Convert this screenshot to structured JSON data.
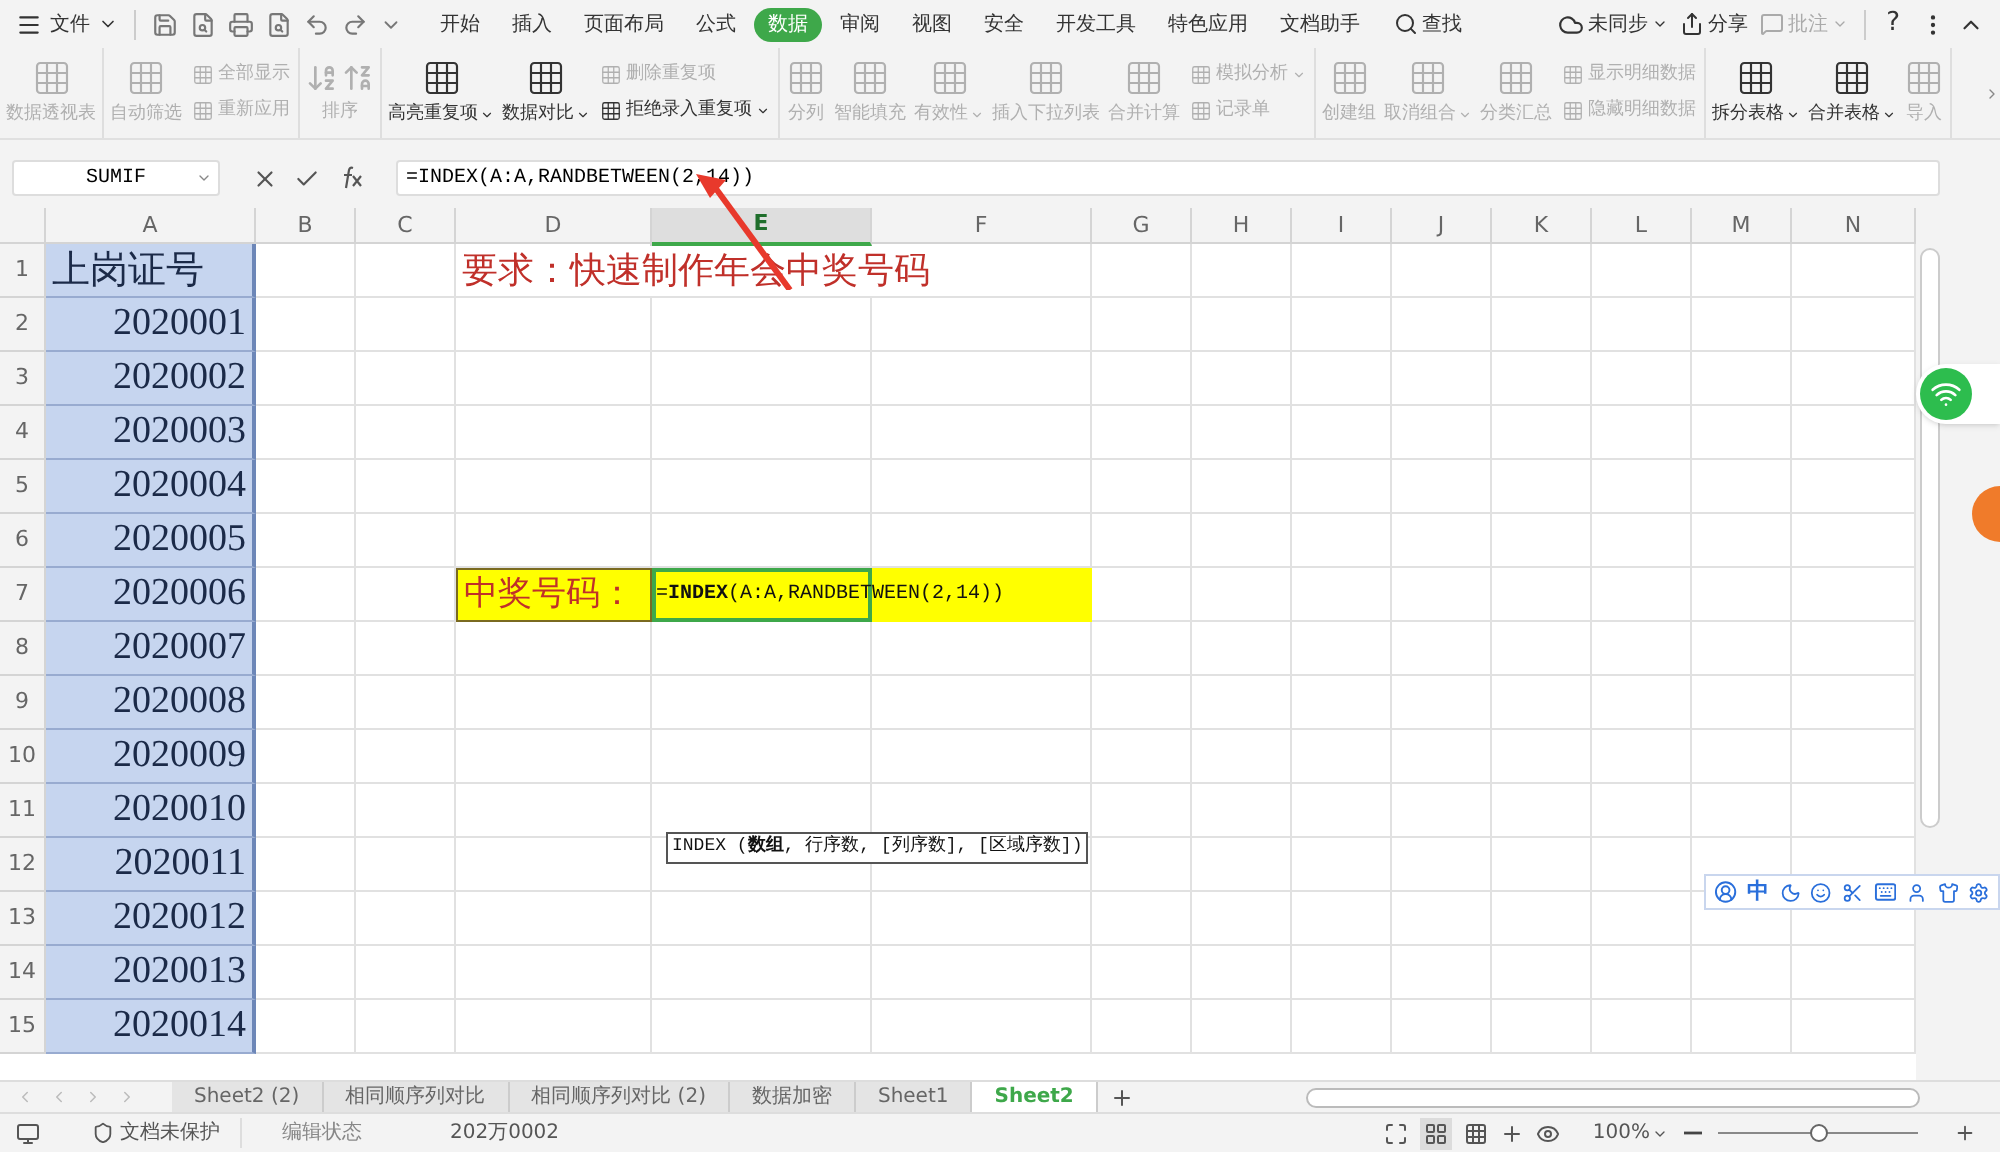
{
  "menu_bar": {
    "file_menu": "文件",
    "tabs": [
      {
        "label": "开始",
        "selected": false
      },
      {
        "label": "插入",
        "selected": false
      },
      {
        "label": "页面布局",
        "selected": false
      },
      {
        "label": "公式",
        "selected": false
      },
      {
        "label": "数据",
        "selected": true
      },
      {
        "label": "审阅",
        "selected": false
      },
      {
        "label": "视图",
        "selected": false
      },
      {
        "label": "安全",
        "selected": false
      },
      {
        "label": "开发工具",
        "selected": false
      },
      {
        "label": "特色应用",
        "selected": false
      },
      {
        "label": "文档助手",
        "selected": false
      }
    ],
    "search": "查找",
    "sync": "未同步",
    "share": "分享",
    "comment": "批注",
    "help": "?"
  },
  "ribbon_groups": [
    [
      {
        "kind": "large",
        "label": "数据透视表",
        "disabled": true,
        "dropdown": false
      }
    ],
    [
      {
        "kind": "large",
        "label": "自动筛选",
        "disabled": true,
        "dropdown": false
      },
      {
        "kind": "stack",
        "items": [
          {
            "label": "全部显示",
            "disabled": true,
            "dropdown": false
          },
          {
            "label": "重新应用",
            "disabled": true,
            "dropdown": false
          }
        ]
      }
    ],
    [
      {
        "kind": "sort",
        "label": "排序",
        "disabled": true,
        "dropdown": false
      }
    ],
    [
      {
        "kind": "large",
        "label": "高亮重复项",
        "disabled": false,
        "dropdown": true
      },
      {
        "kind": "large",
        "label": "数据对比",
        "disabled": false,
        "dropdown": true
      },
      {
        "kind": "stack",
        "items": [
          {
            "label": "删除重复项",
            "disabled": true,
            "dropdown": false
          },
          {
            "label": "拒绝录入重复项",
            "disabled": false,
            "dropdown": true
          }
        ]
      }
    ],
    [
      {
        "kind": "large",
        "label": "分列",
        "disabled": true,
        "dropdown": false
      },
      {
        "kind": "large",
        "label": "智能填充",
        "disabled": true,
        "dropdown": false
      },
      {
        "kind": "large",
        "label": "有效性",
        "disabled": true,
        "dropdown": true
      },
      {
        "kind": "large",
        "label": "插入下拉列表",
        "disabled": true,
        "dropdown": false
      },
      {
        "kind": "large",
        "label": "合并计算",
        "disabled": true,
        "dropdown": false
      },
      {
        "kind": "stack",
        "items": [
          {
            "label": "模拟分析",
            "disabled": true,
            "dropdown": true
          },
          {
            "label": "记录单",
            "disabled": true,
            "dropdown": false
          }
        ]
      }
    ],
    [
      {
        "kind": "large",
        "label": "创建组",
        "disabled": true,
        "dropdown": false
      },
      {
        "kind": "large",
        "label": "取消组合",
        "disabled": true,
        "dropdown": true
      },
      {
        "kind": "large",
        "label": "分类汇总",
        "disabled": true,
        "dropdown": false
      },
      {
        "kind": "stack",
        "items": [
          {
            "label": "显示明细数据",
            "disabled": true,
            "dropdown": false
          },
          {
            "label": "隐藏明细数据",
            "disabled": true,
            "dropdown": false
          }
        ]
      }
    ],
    [
      {
        "kind": "large",
        "label": "拆分表格",
        "disabled": false,
        "dropdown": true
      },
      {
        "kind": "large",
        "label": "合并表格",
        "disabled": false,
        "dropdown": true
      },
      {
        "kind": "large",
        "label": "导入",
        "disabled": true,
        "dropdown": false
      }
    ]
  ],
  "formula_bar": {
    "name_box": "SUMIF",
    "formula": "=INDEX(A:A,RANDBETWEEN(2,14))"
  },
  "sheet": {
    "columns": [
      {
        "label": "A",
        "selected": false
      },
      {
        "label": "B",
        "selected": false
      },
      {
        "label": "C",
        "selected": false
      },
      {
        "label": "D",
        "selected": false
      },
      {
        "label": "E",
        "selected": true
      },
      {
        "label": "F",
        "selected": false
      },
      {
        "label": "G",
        "selected": false
      },
      {
        "label": "H",
        "selected": false
      },
      {
        "label": "I",
        "selected": false
      },
      {
        "label": "J",
        "selected": false
      },
      {
        "label": "K",
        "selected": false
      },
      {
        "label": "L",
        "selected": false
      },
      {
        "label": "M",
        "selected": false
      },
      {
        "label": "N",
        "selected": false
      }
    ],
    "rows": [
      {
        "number": "1",
        "a": "上岗证号"
      },
      {
        "number": "2",
        "a": "2020001"
      },
      {
        "number": "3",
        "a": "2020002"
      },
      {
        "number": "4",
        "a": "2020003"
      },
      {
        "number": "5",
        "a": "2020004"
      },
      {
        "number": "6",
        "a": "2020005"
      },
      {
        "number": "7",
        "a": "2020006"
      },
      {
        "number": "8",
        "a": "2020007"
      },
      {
        "number": "9",
        "a": "2020008"
      },
      {
        "number": "10",
        "a": "2020009"
      },
      {
        "number": "11",
        "a": "2020010"
      },
      {
        "number": "12",
        "a": "2020011"
      },
      {
        "number": "13",
        "a": "2020012"
      },
      {
        "number": "14",
        "a": "2020013"
      },
      {
        "number": "15",
        "a": "2020014"
      }
    ],
    "title": "要求：快速制作年会中奖号码",
    "prize_label": "中奖号码：",
    "prize_formula": "=**INDEX**(A:A,RANDBETWEEN(2,14))",
    "tooltip": "INDEX (**数组**, 行序数, [列序数], [区域序数])"
  },
  "sheet_tabs": [
    {
      "label": "Sheet2 (2)",
      "selected": false
    },
    {
      "label": "相同顺序列对比",
      "selected": false
    },
    {
      "label": "相同顺序列对比 (2)",
      "selected": false
    },
    {
      "label": "数据加密",
      "selected": false
    },
    {
      "label": "Sheet1",
      "selected": false
    },
    {
      "label": "Sheet2",
      "selected": true
    }
  ],
  "status_bar": {
    "protection": "文档未保护",
    "mode": "编辑状态",
    "value": "202万0002",
    "zoom": "100%",
    "zoom_slider": {
      "level": 0.5
    }
  },
  "ime_toolbar": {
    "mode": "中"
  }
}
